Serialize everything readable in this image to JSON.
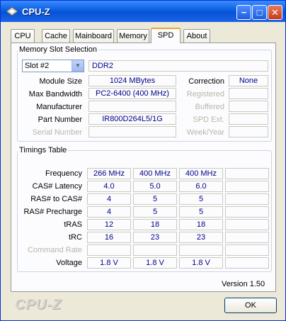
{
  "window": {
    "title": "CPU-Z",
    "controls": {
      "minimize": "−",
      "maximize": "□",
      "close": "✕"
    }
  },
  "tabs": [
    {
      "label": "CPU"
    },
    {
      "label": "Cache"
    },
    {
      "label": "Mainboard"
    },
    {
      "label": "Memory"
    },
    {
      "label": "SPD",
      "active": true
    },
    {
      "label": "About"
    }
  ],
  "memory_slot": {
    "legend": "Memory Slot Selection",
    "slot_select": "Slot #2",
    "type": "DDR2",
    "module_size_label": "Module Size",
    "module_size": "1024 MBytes",
    "max_bandwidth_label": "Max Bandwidth",
    "max_bandwidth": "PC2-6400 (400 MHz)",
    "manufacturer_label": "Manufacturer",
    "manufacturer": "",
    "part_number_label": "Part Number",
    "part_number": "IR800D264L5/1G",
    "serial_number_label": "Serial Number",
    "serial_number": "",
    "correction_label": "Correction",
    "correction": "None",
    "registered_label": "Registered",
    "registered": "",
    "buffered_label": "Buffered",
    "buffered": "",
    "spd_ext_label": "SPD Ext.",
    "spd_ext": "",
    "week_year_label": "Week/Year",
    "week_year": ""
  },
  "timings": {
    "legend": "Timings Table",
    "rows": [
      {
        "label": "Frequency",
        "values": [
          "266 MHz",
          "400 MHz",
          "400 MHz",
          ""
        ]
      },
      {
        "label": "CAS# Latency",
        "values": [
          "4.0",
          "5.0",
          "6.0",
          ""
        ]
      },
      {
        "label": "RAS# to CAS#",
        "values": [
          "4",
          "5",
          "5",
          ""
        ]
      },
      {
        "label": "RAS# Precharge",
        "values": [
          "4",
          "5",
          "5",
          ""
        ]
      },
      {
        "label": "tRAS",
        "values": [
          "12",
          "18",
          "18",
          ""
        ]
      },
      {
        "label": "tRC",
        "values": [
          "16",
          "23",
          "23",
          ""
        ]
      },
      {
        "label": "Command Rate",
        "values": [
          "",
          "",
          "",
          ""
        ],
        "dim": true
      },
      {
        "label": "Voltage",
        "values": [
          "1.8 V",
          "1.8 V",
          "1.8 V",
          ""
        ]
      }
    ]
  },
  "footer": {
    "version": "Version 1.50",
    "brand": "CPU-Z",
    "ok_label": "OK"
  }
}
